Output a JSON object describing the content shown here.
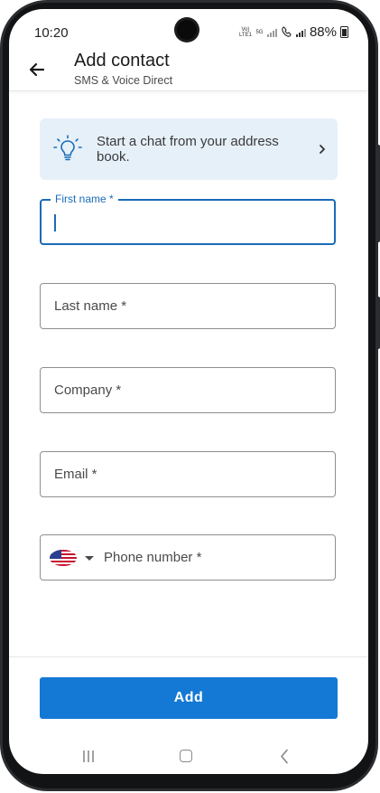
{
  "status_bar": {
    "time": "10:20",
    "volte_label": "Vo) LTE1",
    "network_label": "5G",
    "battery_percent": "88%"
  },
  "app_bar": {
    "title": "Add contact",
    "subtitle": "SMS & Voice Direct"
  },
  "banner": {
    "text": "Start a chat from your address book."
  },
  "form": {
    "first_name_label": "First name *",
    "last_name_placeholder": "Last name *",
    "company_placeholder": "Company *",
    "email_placeholder": "Email *",
    "phone_placeholder": "Phone number *",
    "country_flag": "us-flag-icon"
  },
  "actions": {
    "add_label": "Add"
  },
  "colors": {
    "accent": "#1479d4",
    "focus_border": "#1a6bb8",
    "banner_bg": "#e6f0f9"
  }
}
